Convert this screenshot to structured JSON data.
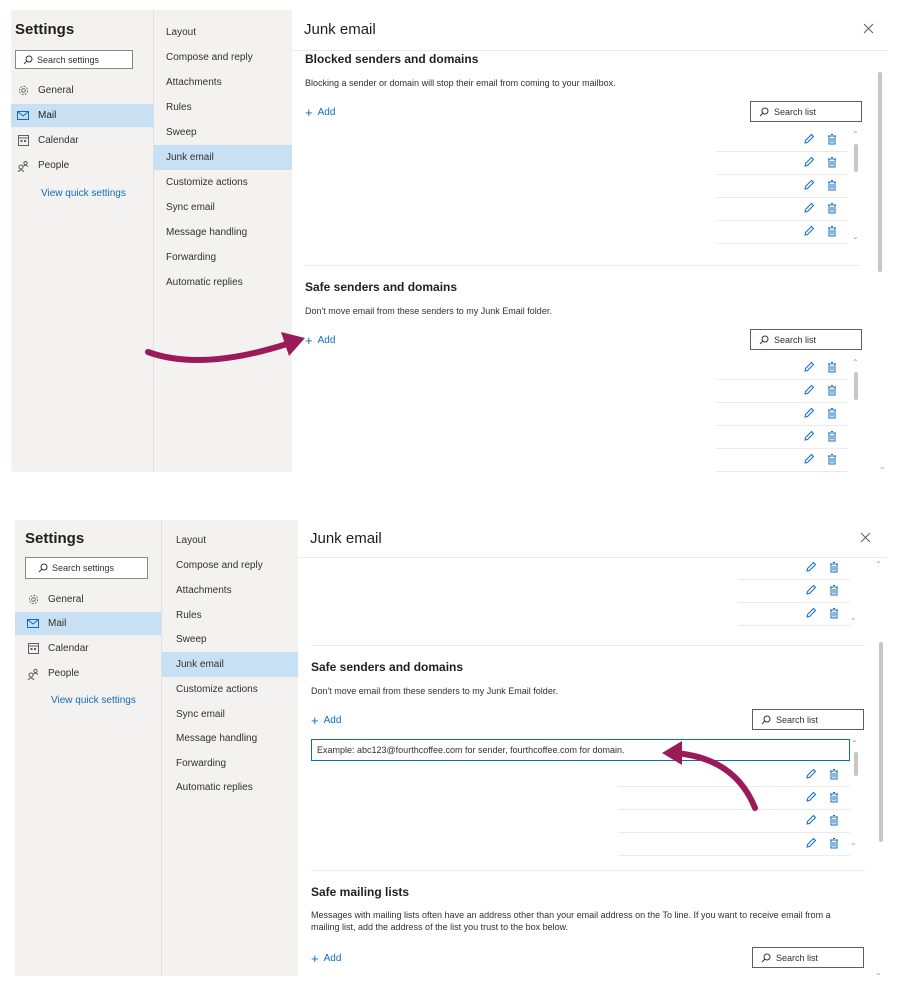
{
  "settings_title": "Settings",
  "search_settings_placeholder": "Search settings",
  "nav_primary": [
    {
      "label": "General",
      "icon": "gear-icon"
    },
    {
      "label": "Mail",
      "icon": "mail-icon"
    },
    {
      "label": "Calendar",
      "icon": "calendar-icon"
    },
    {
      "label": "People",
      "icon": "people-icon"
    }
  ],
  "view_quick_settings": "View quick settings",
  "nav_mail": [
    "Layout",
    "Compose and reply",
    "Attachments",
    "Rules",
    "Sweep",
    "Junk email",
    "Customize actions",
    "Sync email",
    "Message handling",
    "Forwarding",
    "Automatic replies"
  ],
  "selected_primary": "Mail",
  "selected_mail": "Junk email",
  "page_title": "Junk email",
  "blocked": {
    "title": "Blocked senders and domains",
    "desc": "Blocking a sender or domain will stop their email from coming to your mailbox.",
    "add": "Add",
    "search_placeholder": "Search list"
  },
  "safe_senders": {
    "title": "Safe senders and domains",
    "desc": "Don't move email from these senders to my Junk Email folder.",
    "add": "Add",
    "search_placeholder": "Search list",
    "input_placeholder": "Example: abc123@fourthcoffee.com for sender, fourthcoffee.com for domain."
  },
  "safe_mailing": {
    "title": "Safe mailing lists",
    "desc": "Messages with mailing lists often have an address other than your email address on the To line. If you want to receive email from a mailing list, add the address of the list you trust to the box below.",
    "add": "Add",
    "search_placeholder": "Search list"
  },
  "colors": {
    "accent": "#0f6cbd",
    "selected": "#c7e0f4",
    "nav_bg": "#f3f2f1",
    "annotation_arrow": "#9b1b5a"
  }
}
